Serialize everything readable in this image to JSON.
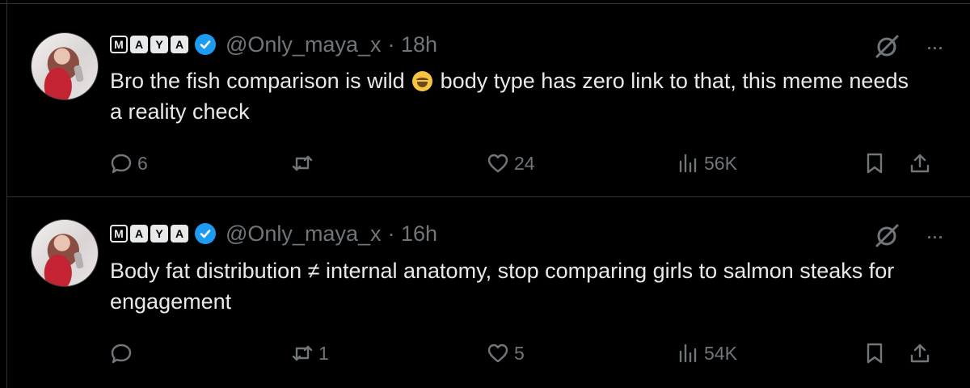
{
  "tweets": [
    {
      "display_name_letters": [
        "M",
        "A",
        "Y",
        "A"
      ],
      "handle": "@Only_maya_x",
      "time": "· 18h",
      "text_before_emoji": "Bro the fish comparison is wild ",
      "emoji": "face-with-tears-of-joy",
      "text_after_emoji": " body type has zero link to that, this meme needs a reality check",
      "replies": "6",
      "retweets": "",
      "likes": "24",
      "views": "56K"
    },
    {
      "display_name_letters": [
        "M",
        "A",
        "Y",
        "A"
      ],
      "handle": "@Only_maya_x",
      "time": "· 16h",
      "text": "Body fat distribution ≠ internal anatomy, stop comparing girls to salmon steaks for engagement",
      "replies": "",
      "retweets": "1",
      "likes": "5",
      "views": "54K"
    }
  ],
  "colors": {
    "background": "#000000",
    "text": "#e7e9ea",
    "muted": "#71767b",
    "verified": "#1d9bf0",
    "divider": "#2f3336"
  }
}
